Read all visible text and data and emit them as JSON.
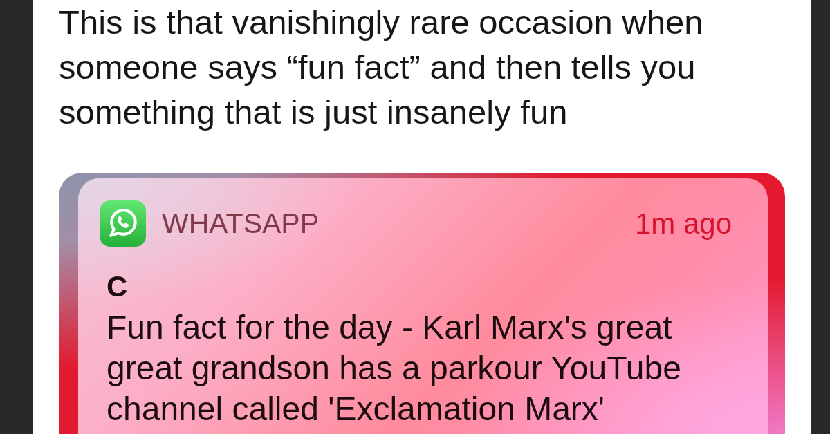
{
  "post": {
    "text": "This is that vanishingly rare occasion when someone says “fun fact” and then tells you something that is just insanely fun"
  },
  "notification": {
    "app": "WHATSAPP",
    "time": "1m ago",
    "sender": "C",
    "message": "Fun fact for the day - Karl Marx's great great grandson has a parkour YouTube channel called 'Exclamation Marx'"
  }
}
